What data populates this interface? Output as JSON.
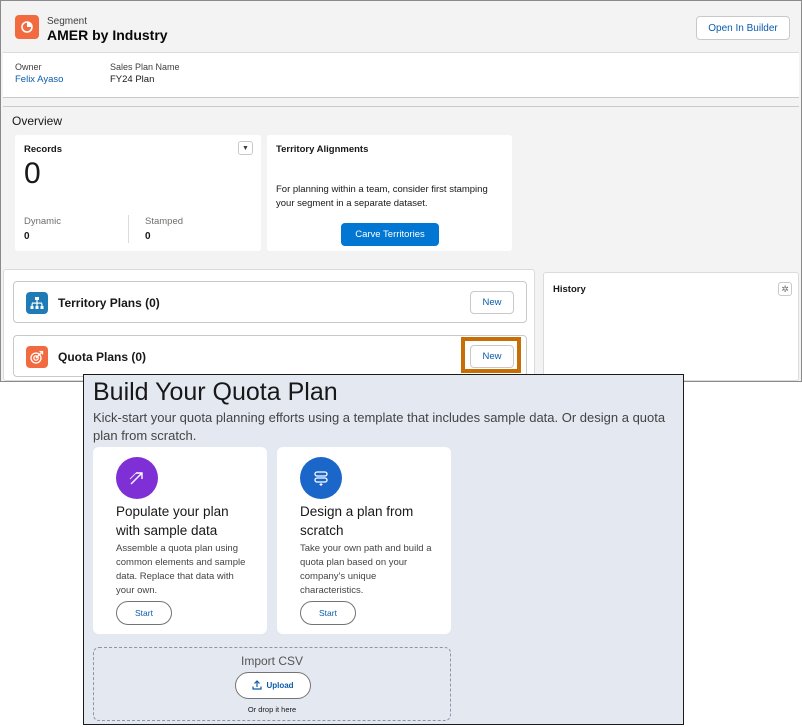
{
  "header": {
    "kicker": "Segment",
    "title": "AMER by Industry",
    "open_builder_label": "Open In Builder",
    "owner_label": "Owner",
    "owner_value": "Felix Ayaso",
    "sales_plan_label": "Sales Plan Name",
    "sales_plan_value": "FY24 Plan"
  },
  "overview": {
    "title": "Overview",
    "records": {
      "title": "Records",
      "total": "0",
      "dynamic_label": "Dynamic",
      "dynamic_value": "0",
      "stamped_label": "Stamped",
      "stamped_value": "0"
    },
    "alignments": {
      "title": "Territory Alignments",
      "text": "For planning within a team, consider first stamping your segment in a separate dataset.",
      "button_label": "Carve Territories"
    }
  },
  "plans": {
    "territory": {
      "title": "Territory Plans (0)",
      "new_label": "New",
      "color": "#1f7bb6"
    },
    "quota": {
      "title": "Quota Plans (0)",
      "new_label": "New",
      "color": "#f26a3f"
    }
  },
  "history": {
    "title": "History"
  },
  "build": {
    "title": "Build Your Quota Plan",
    "subtitle": "Kick-start your quota planning efforts using a template that includes sample data. Or design a quota plan from scratch.",
    "tiles": [
      {
        "title": "Populate your plan with sample data",
        "description": "Assemble a quota plan using common elements and sample data. Replace that data with your own.",
        "start_label": "Start",
        "icon_color": "#7f2fd6"
      },
      {
        "title": "Design a plan from scratch",
        "description": "Take your own path and build a quota plan based on your company's unique characteristics.",
        "start_label": "Start",
        "icon_color": "#1b66c9"
      }
    ],
    "import": {
      "title": "Import CSV",
      "upload_label": "Upload",
      "hint": "Or drop it here"
    }
  },
  "colors": {
    "brand_blue": "#0176d3",
    "link_blue": "#0b5cab",
    "highlight": "#c76f06"
  }
}
